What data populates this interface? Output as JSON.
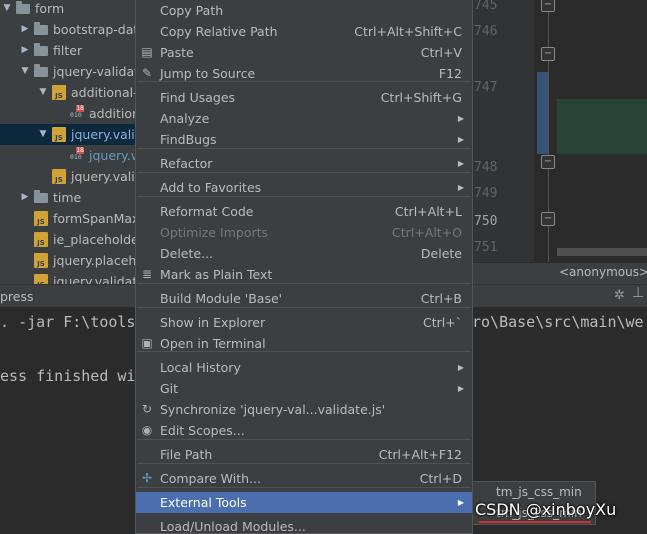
{
  "tree": {
    "rows": [
      {
        "label": "form",
        "type": "folder",
        "expanded": true,
        "indent": 0
      },
      {
        "label": "bootstrap-daterangepicker",
        "type": "folder",
        "expanded": false,
        "indent": 1
      },
      {
        "label": "filter",
        "type": "folder",
        "expanded": false,
        "indent": 1
      },
      {
        "label": "jquery-validation",
        "type": "folder",
        "expanded": true,
        "indent": 1
      },
      {
        "label": "additional-methods.js",
        "type": "js",
        "expanded": true,
        "indent": 2
      },
      {
        "label": "additional-methods.min.js",
        "type": "bin",
        "indent": 3
      },
      {
        "label": "jquery.validate.js",
        "type": "js",
        "expanded": true,
        "indent": 2,
        "selected": true
      },
      {
        "label": "jquery.validate.min.js",
        "type": "bin",
        "indent": 3,
        "blue": true
      },
      {
        "label": "jquery.validate.unobtrusive.js",
        "type": "js",
        "indent": 2
      },
      {
        "label": "time",
        "type": "folder",
        "expanded": false,
        "indent": 1
      },
      {
        "label": "formSpanMaxWidth.js",
        "type": "js",
        "indent": 1
      },
      {
        "label": "ie_placeholder.js",
        "type": "js",
        "indent": 1
      },
      {
        "label": "jquery.placeholder.js",
        "type": "js",
        "indent": 1
      },
      {
        "label": "jquery.validate.ext.js",
        "type": "js",
        "indent": 1
      }
    ]
  },
  "editor": {
    "line_numbers": [
      "745",
      "746",
      "747",
      "748",
      "749",
      "750",
      "751"
    ],
    "current_line": "750",
    "breadcrumb": "<anonymous>("
  },
  "run_panel": {
    "title": "press",
    "lines": [
      ". -jar F:\\tools\\",
      "ess finished wi",
      "ro\\Base\\src\\main\\we"
    ]
  },
  "menu": {
    "items": [
      {
        "label": "Copy Path",
        "shortcut": "",
        "icon": ""
      },
      {
        "label": "Copy Relative Path",
        "shortcut": "Ctrl+Alt+Shift+C",
        "icon": ""
      },
      {
        "label": "Paste",
        "shortcut": "Ctrl+V",
        "icon": "paste-icon"
      },
      {
        "label": "Jump to Source",
        "shortcut": "F12",
        "icon": "edit-icon"
      },
      {
        "label": "Find Usages",
        "shortcut": "Ctrl+Shift+G",
        "icon": ""
      },
      {
        "label": "Analyze",
        "shortcut": "",
        "icon": "",
        "submenu": true
      },
      {
        "label": "FindBugs",
        "shortcut": "",
        "icon": "",
        "submenu": true
      },
      {
        "label": "Refactor",
        "shortcut": "",
        "icon": "",
        "submenu": true
      },
      {
        "label": "Add to Favorites",
        "shortcut": "",
        "icon": "",
        "submenu": true
      },
      {
        "label": "Reformat Code",
        "shortcut": "Ctrl+Alt+L",
        "icon": ""
      },
      {
        "label": "Optimize Imports",
        "shortcut": "Ctrl+Alt+O",
        "icon": "",
        "disabled": true
      },
      {
        "label": "Delete...",
        "shortcut": "Delete",
        "icon": ""
      },
      {
        "label": "Mark as Plain Text",
        "shortcut": "",
        "icon": "plain-text-icon"
      },
      {
        "label": "Build Module 'Base'",
        "shortcut": "Ctrl+B",
        "icon": ""
      },
      {
        "label": "Show in Explorer",
        "shortcut": "Ctrl+`",
        "icon": ""
      },
      {
        "label": "Open in Terminal",
        "shortcut": "",
        "icon": "terminal-icon"
      },
      {
        "label": "Local History",
        "shortcut": "",
        "icon": "",
        "submenu": true
      },
      {
        "label": "Git",
        "shortcut": "",
        "icon": "",
        "submenu": true
      },
      {
        "label": "Synchronize 'jquery-val...validate.js'",
        "shortcut": "",
        "icon": "sync-icon"
      },
      {
        "label": "Edit Scopes...",
        "shortcut": "",
        "icon": "scope-icon"
      },
      {
        "label": "File Path",
        "shortcut": "Ctrl+Alt+F12",
        "icon": ""
      },
      {
        "label": "Compare With...",
        "shortcut": "Ctrl+D",
        "icon": "compare-icon"
      },
      {
        "label": "External Tools",
        "shortcut": "",
        "icon": "",
        "submenu": true,
        "highlighted": true
      },
      {
        "label": "Load/Unload Modules...",
        "shortcut": "",
        "icon": ""
      }
    ]
  },
  "submenu": {
    "items": [
      {
        "label": "tm_js_css_min"
      },
      {
        "label": "tm_js_css_min"
      }
    ]
  },
  "watermark": "CSDN @xinboyXu",
  "colors": {
    "menu_bg": "#3c3f41",
    "highlight": "#4b6eaf",
    "editor_bg": "#2b2b2b",
    "selection": "#0d293e",
    "underline": "#d03030"
  }
}
